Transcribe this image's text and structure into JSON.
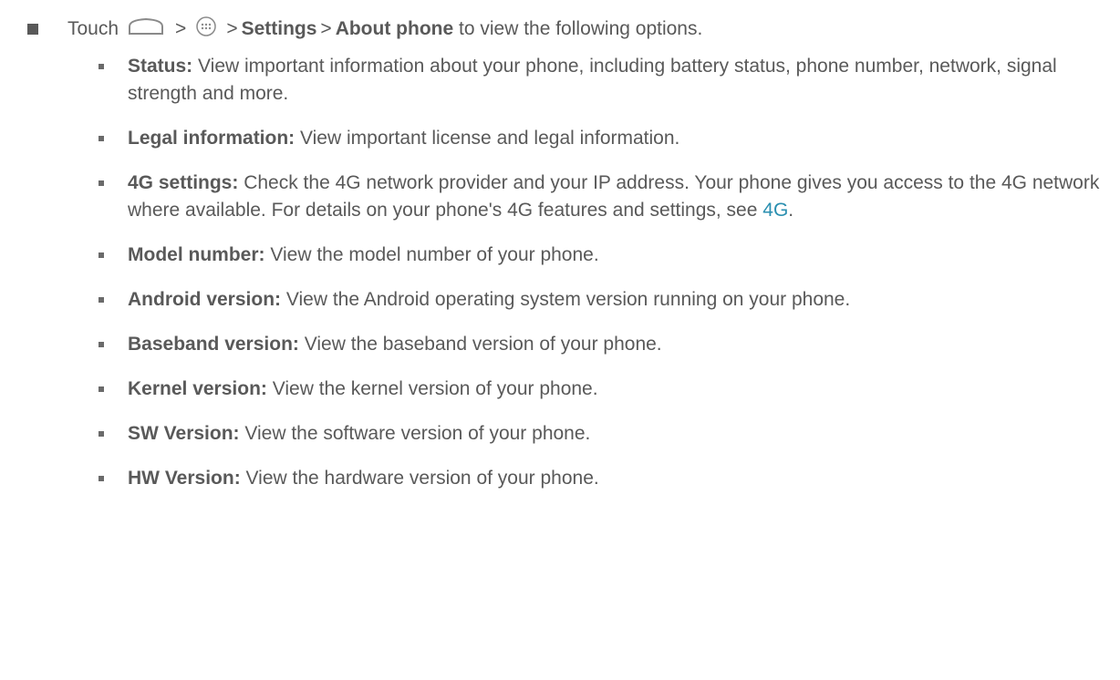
{
  "intro": {
    "touch": "Touch",
    "sep1": ">",
    "sep2": ">",
    "settings": "Settings",
    "sep3": ">",
    "about_phone": "About phone",
    "tail": "to view the following options.",
    "icons": [
      "home-icon",
      "apps-icon"
    ]
  },
  "items": [
    {
      "term": "Status:",
      "desc": "View important information about your phone, including battery status, phone number, network, signal strength and more."
    },
    {
      "term": "Legal information:",
      "desc": "View important license and legal information."
    },
    {
      "term": "4G settings:",
      "desc": "Check the 4G network provider and your IP address. Your phone gives you access to the 4G network where available. For details on your phone's 4G features and settings, see",
      "link": "4G",
      "after": "."
    },
    {
      "term": "Model number:",
      "desc": "View the model number of your phone."
    },
    {
      "term": "Android version:",
      "desc": "View the Android operating system version running on your phone."
    },
    {
      "term": "Baseband version:",
      "desc": "View the baseband version of your phone."
    },
    {
      "term": "Kernel version:",
      "desc": "View the kernel version of your phone."
    },
    {
      "term": "SW Version:",
      "desc": "View the software version of your phone."
    },
    {
      "term": "HW Version:",
      "desc": "View the hardware version of your phone."
    }
  ],
  "colors": {
    "text": "#595959",
    "link": "#2a8fb0"
  }
}
